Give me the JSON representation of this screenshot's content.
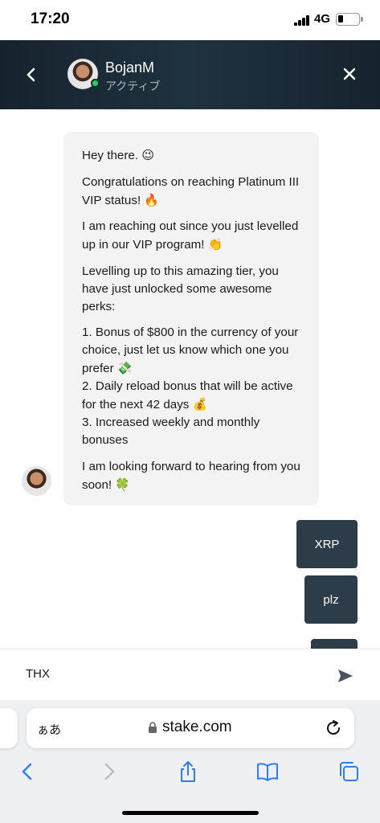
{
  "status_bar": {
    "time": "17:20",
    "network": "4G"
  },
  "header": {
    "agent_name": "BojanM",
    "agent_status": "アクティブ"
  },
  "messages": {
    "incoming": [
      {
        "text": "Hey there.",
        "emoji": "😉"
      },
      {
        "text": "Congratulations on reaching Platinum III VIP status!",
        "emoji": "🔥"
      },
      {
        "text": "I am reaching out since you just levelled up in our VIP program!",
        "emoji": "👏"
      },
      {
        "text": "Levelling up to this amazing tier, you have just unlocked some awesome perks:",
        "emoji": ""
      },
      {
        "perk1": "1. Bonus of $800 in the currency of your choice, just let us know which one you prefer",
        "emoji1": "💸",
        "perk2": "2. Daily reload bonus that will be active for the next 42 days",
        "emoji2": "💰",
        "perk3": "3. Increased weekly and monthly bonuses"
      },
      {
        "text": "I am looking forward to hearing from you soon!",
        "emoji": "🍀"
      }
    ],
    "outgoing": [
      "XRP",
      "plz",
      ""
    ]
  },
  "composer": {
    "value": "THX"
  },
  "browser": {
    "text_size_label": "ぁあ",
    "url": "stake.com"
  },
  "colors": {
    "header_bg": "#1d2c38",
    "outgoing_bubble": "#2d3c49",
    "incoming_bubble": "#f3f3f4",
    "online": "#1fd15f",
    "ios_blue": "#2f7cf6"
  },
  "icons": [
    "back-icon",
    "close-icon",
    "send-icon",
    "lock-icon",
    "reload-icon",
    "share-icon",
    "bookmarks-icon",
    "tabs-icon"
  ]
}
